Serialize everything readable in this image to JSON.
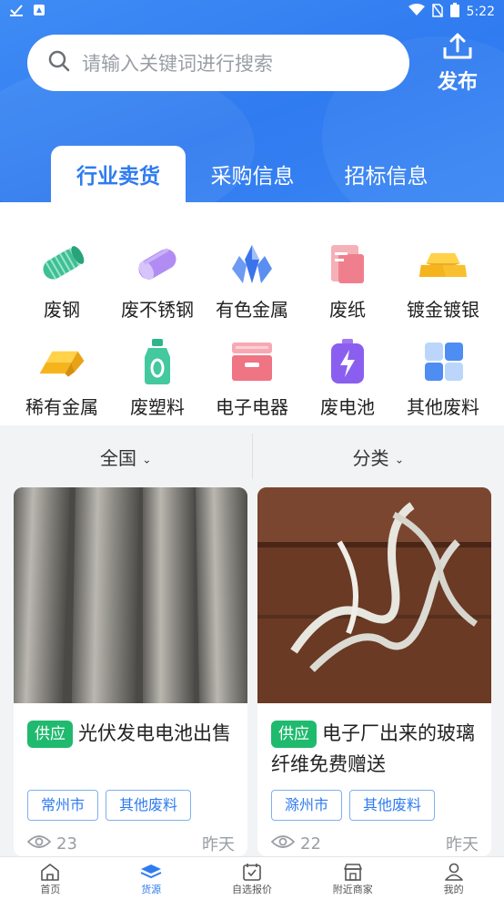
{
  "status_bar": {
    "time": "5:22"
  },
  "search": {
    "placeholder": "请输入关键词进行搜索"
  },
  "publish": {
    "label": "发布"
  },
  "tabs": [
    {
      "label": "行业卖货",
      "active": true
    },
    {
      "label": "采购信息",
      "active": false
    },
    {
      "label": "招标信息",
      "active": false
    }
  ],
  "categories": [
    {
      "label": "废钢",
      "icon": "steel-coil-icon"
    },
    {
      "label": "废不锈钢",
      "icon": "stainless-rod-icon"
    },
    {
      "label": "有色金属",
      "icon": "crystal-icon"
    },
    {
      "label": "废纸",
      "icon": "paper-icon"
    },
    {
      "label": "镀金镀银",
      "icon": "gold-bar-icon"
    },
    {
      "label": "稀有金属",
      "icon": "ingot-icon"
    },
    {
      "label": "废塑料",
      "icon": "plastic-bottle-icon"
    },
    {
      "label": "电子电器",
      "icon": "drawer-cabinet-icon"
    },
    {
      "label": "废电池",
      "icon": "battery-icon"
    },
    {
      "label": "其他废料",
      "icon": "grid-blocks-icon"
    }
  ],
  "filters": {
    "region": "全国",
    "category": "分类"
  },
  "listings": [
    {
      "badge": "供应",
      "title": "光伏发电电池出售",
      "tags": [
        "常州市",
        "其他废料"
      ],
      "views": "23",
      "time": "昨天"
    },
    {
      "badge": "供应",
      "title": "电子厂出来的玻璃纤维免费赠送",
      "tags": [
        "滁州市",
        "其他废料"
      ],
      "views": "22",
      "time": "昨天"
    }
  ],
  "bottom_nav": [
    {
      "label": "首页",
      "icon": "home-icon",
      "active": false
    },
    {
      "label": "货源",
      "icon": "layers-icon",
      "active": true
    },
    {
      "label": "自选报价",
      "icon": "calendar-check-icon",
      "active": false
    },
    {
      "label": "附近商家",
      "icon": "store-icon",
      "active": false
    },
    {
      "label": "我的",
      "icon": "user-icon",
      "active": false
    }
  ],
  "colors": {
    "primary": "#2f7bf0",
    "supply_badge": "#1fba6e"
  }
}
